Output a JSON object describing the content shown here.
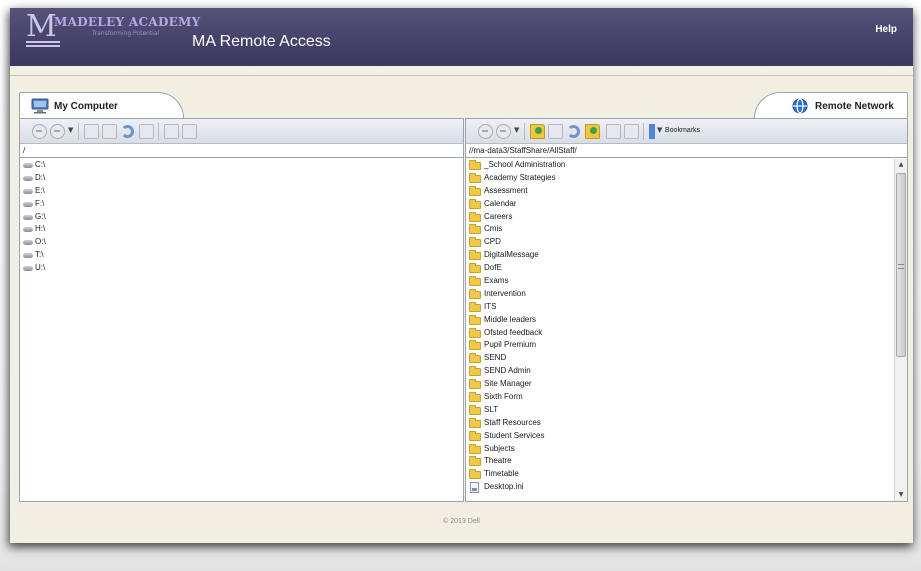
{
  "header": {
    "logo_initial": "M",
    "logo_name": "Madeley Academy",
    "logo_tagline": "Transforming Potential",
    "app_title": "MA Remote Access",
    "help_label": "Help"
  },
  "left_panel": {
    "tab_label": "My Computer",
    "tab_icon": "computer-icon",
    "path": "/",
    "drives": [
      "C:\\",
      "D:\\",
      "E:\\",
      "F:\\",
      "G:\\",
      "H:\\",
      "O:\\",
      "T:\\",
      "U:\\"
    ]
  },
  "right_panel": {
    "tab_label": "Remote Network",
    "tab_icon": "globe-icon",
    "path": "//ma-data3/StaffShare/AllStaff/",
    "bookmarks_label": "Bookmarks",
    "folders": [
      "_School Administration",
      "Academy Strategies",
      "Assessment",
      "Calendar",
      "Careers",
      "Cmis",
      "CPD",
      "DigitalMessage",
      "DofE",
      "Exams",
      "Intervention",
      "ITS",
      "Middle leaders",
      "Ofsted feedback",
      "Pupil Premium",
      "SEND",
      "SEND Admin",
      "Site Manager",
      "Sixth Form",
      "SLT",
      "Staff Resources",
      "Student Services",
      "Subjects",
      "Theatre",
      "Timetable"
    ],
    "files": [
      "Desktop.ini"
    ]
  },
  "footer": {
    "copyright": "© 2013 Dell"
  },
  "colors": {
    "header": "#45436a",
    "accent": "#cfc4ee",
    "folder": "#f0c94a"
  }
}
